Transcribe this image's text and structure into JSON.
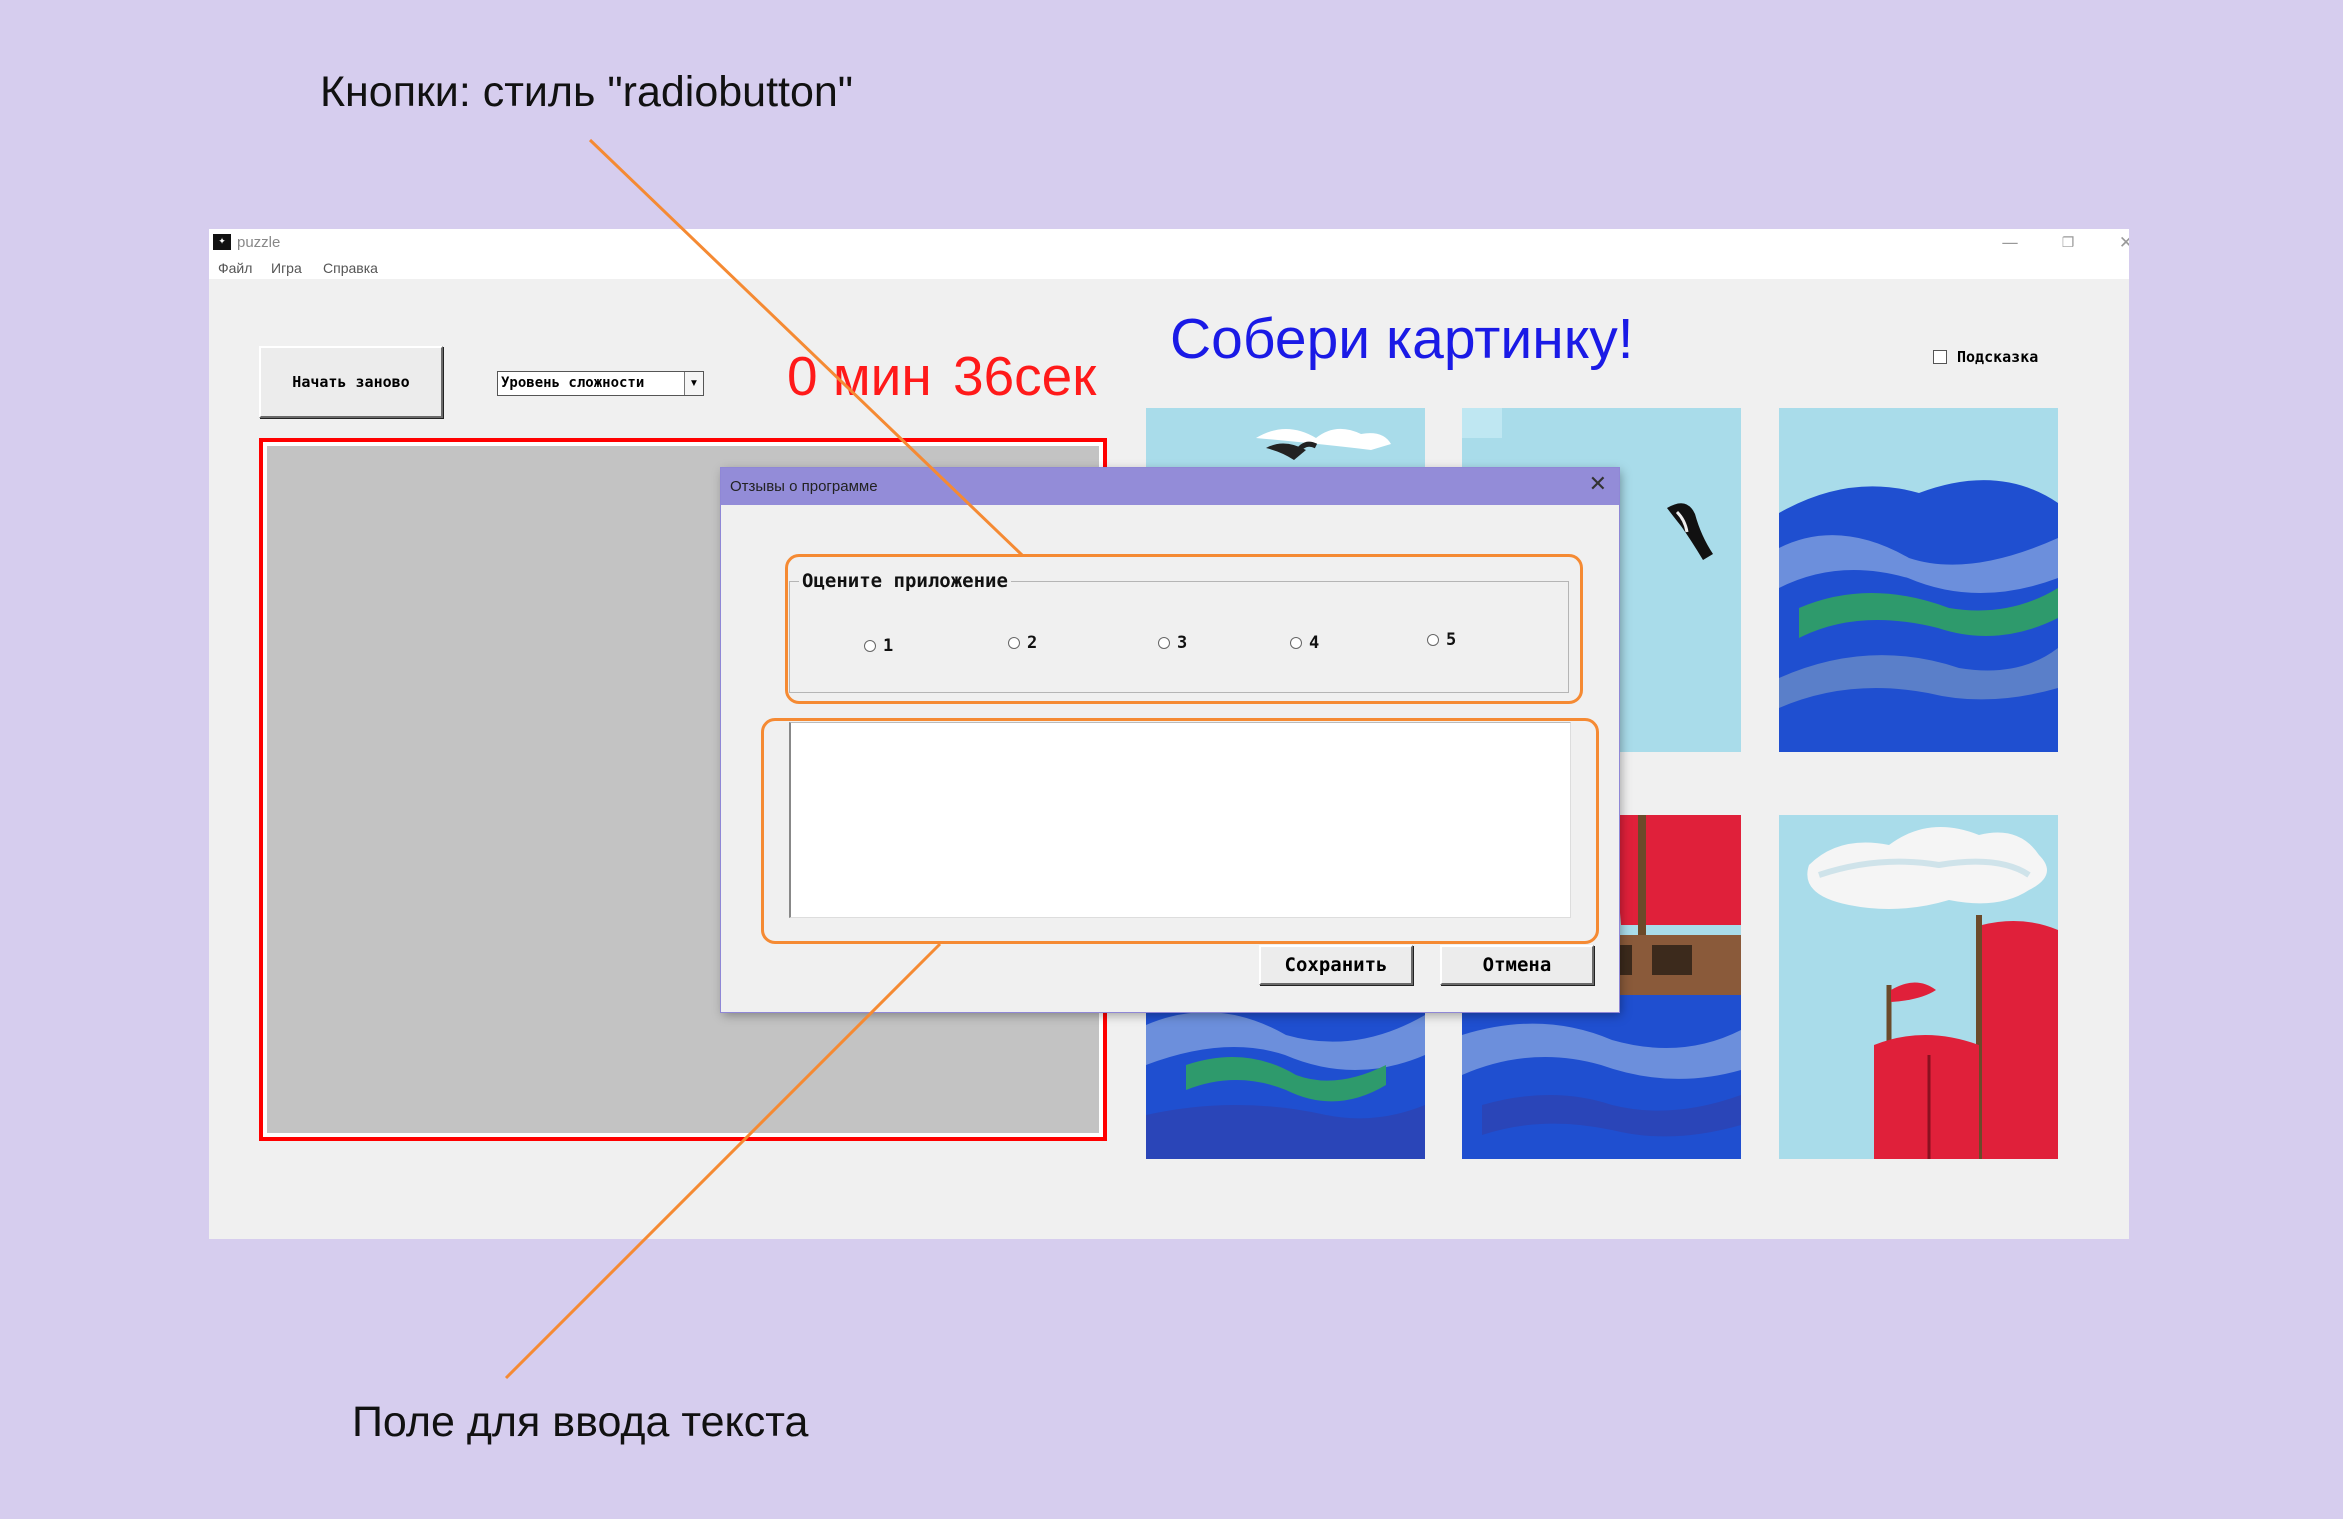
{
  "annotations": {
    "top": "Кнопки: стиль \"radiobutton\"",
    "bottom": "Поле для ввода текста"
  },
  "window": {
    "title": "puzzle",
    "controls": {
      "minimize": "—",
      "maximize": "❐",
      "close": "✕"
    },
    "menu": [
      "Файл",
      "Игра",
      "Справка"
    ]
  },
  "toolbar": {
    "restart_label": "Начать заново",
    "difficulty_selected": "Уровень сложности",
    "timer_minutes": "0 мин",
    "timer_seconds": "36сек"
  },
  "heading": "Собери картинку!",
  "hint": {
    "label": "Подсказка",
    "checked": false
  },
  "colors": {
    "background": "#d6cdee",
    "timer": "#ff1a1a",
    "heading": "#1a1ae6",
    "board_border": "#ff0000",
    "dialog_titlebar": "#938cd8",
    "callout": "#f58a33",
    "sky": "#a9dcea",
    "sea": "#1f4fd0",
    "sail": "#e0203a"
  },
  "tiles": [
    {
      "icon": "puzzle-tile-sky-birds"
    },
    {
      "icon": "puzzle-tile-sky-bird"
    },
    {
      "icon": "puzzle-tile-sea-waves"
    },
    {
      "icon": "puzzle-tile-sea"
    },
    {
      "icon": "puzzle-tile-ship-deck"
    },
    {
      "icon": "puzzle-tile-red-sails"
    }
  ],
  "dialog": {
    "title": "Отзывы о программе",
    "close": "✕",
    "rating_legend": "Оцените приложение",
    "rating_options": [
      "1",
      "2",
      "3",
      "4",
      "5"
    ],
    "rating_selected": null,
    "feedback_text": "",
    "save_label": "Сохранить",
    "cancel_label": "Отмена"
  }
}
